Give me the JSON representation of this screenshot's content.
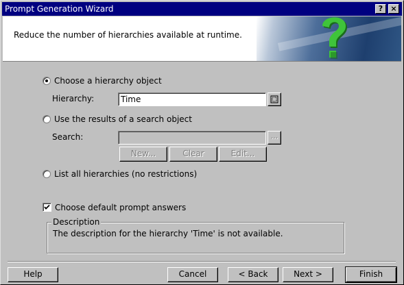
{
  "window": {
    "title": "Prompt Generation Wizard",
    "help_button": "?",
    "close_button": "×"
  },
  "header": {
    "text": "Reduce the number of hierarchies available at runtime."
  },
  "options": {
    "hierarchy_radio": "Choose a hierarchy object",
    "hierarchy_label": "Hierarchy:",
    "hierarchy_value": "Time",
    "search_radio": "Use the results of a search object",
    "search_label": "Search:",
    "search_value": "",
    "search_browse": "...",
    "new_button": "New...",
    "clear_button": "Clear",
    "edit_button": "Edit...",
    "list_radio": "List all hierarchies (no restrictions)",
    "default_checkbox": "Choose default prompt answers",
    "selected_option": "hierarchy",
    "default_checked": true
  },
  "description": {
    "title": "Description",
    "text": "The description for the hierarchy 'Time' is not available."
  },
  "footer": {
    "help": "Help",
    "cancel": "Cancel",
    "back": "< Back",
    "next": "Next >",
    "finish": "Finish"
  },
  "icons": {
    "banner": "question-mark-icon",
    "browse": "browse-icon",
    "check": "checkmark-icon"
  },
  "colors": {
    "titlebar": "#000080",
    "face": "#c0c0c0",
    "banner_accent": "#2f5684",
    "question_mark": "#3fc43a"
  }
}
